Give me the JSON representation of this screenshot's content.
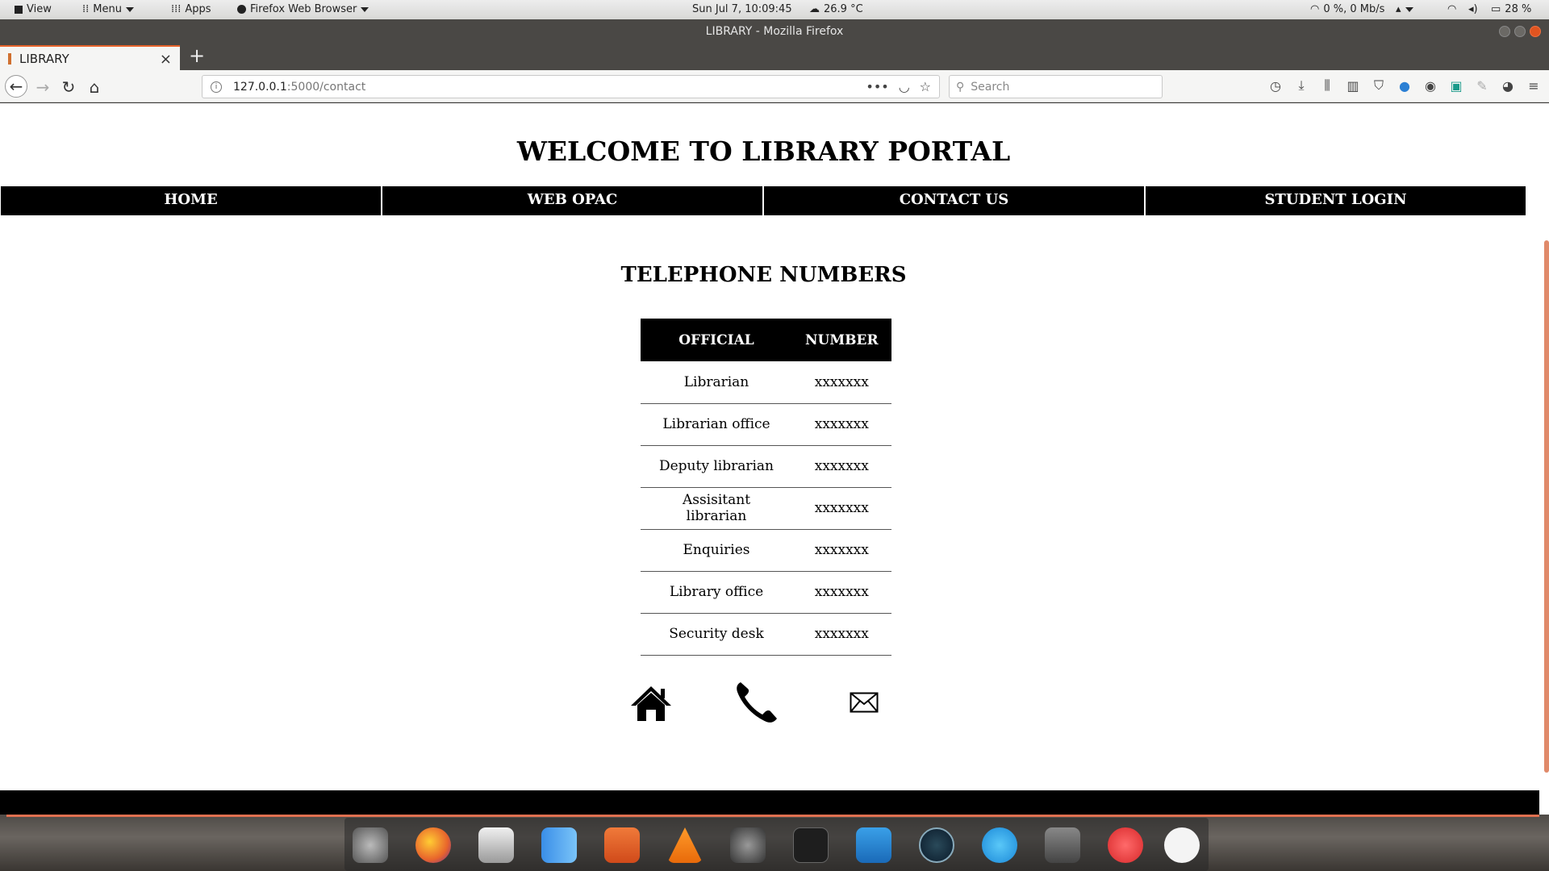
{
  "system_panel": {
    "view": "View",
    "menu": "Menu",
    "apps": "Apps",
    "active_app": "Firefox Web Browser",
    "datetime": "Sun Jul  7, 10:09:45",
    "weather": "26.9 °C",
    "network": "0 %, 0 Mb/s",
    "battery": "28 %"
  },
  "window": {
    "title": "LIBRARY - Mozilla Firefox"
  },
  "browser": {
    "tab_title": "LIBRARY",
    "url_host": "127.0.0.1",
    "url_path": ":5000/contact",
    "search_placeholder": "Search"
  },
  "page": {
    "site_title": "WELCOME TO LIBRARY PORTAL",
    "nav": [
      "HOME",
      "WEB OPAC",
      "CONTACT US",
      "STUDENT LOGIN"
    ],
    "section_title": "TELEPHONE NUMBERS",
    "table": {
      "headers": [
        "OFFICIAL",
        "NUMBER"
      ],
      "rows": [
        [
          "Librarian",
          "xxxxxxx"
        ],
        [
          "Librarian office",
          "xxxxxxx"
        ],
        [
          "Deputy librarian",
          "xxxxxxx"
        ],
        [
          "Assisitant librarian",
          "xxxxxxx"
        ],
        [
          "Enquiries",
          "xxxxxxx"
        ],
        [
          "Library office",
          "xxxxxxx"
        ],
        [
          "Security desk",
          "xxxxxxx"
        ]
      ]
    },
    "footer_icons": [
      "home-icon",
      "phone-icon",
      "mail-icon"
    ]
  },
  "dock_apps": [
    "system-settings-icon",
    "firefox-icon",
    "installer-icon",
    "finder-icon",
    "image-editor-icon",
    "vlc-icon",
    "gear-icon",
    "terminal-icon",
    "vscode-icon",
    "stacer-icon",
    "settings-icon",
    "font-app-icon",
    "help-icon",
    "app-icon"
  ],
  "colors": {
    "tab_accent": "#e8642c",
    "nav_bg": "#000000",
    "dock_line": "#e07050"
  }
}
